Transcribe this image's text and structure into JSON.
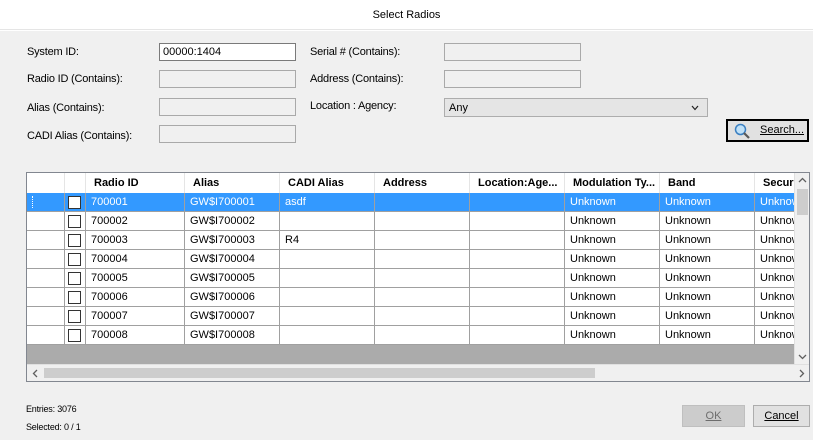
{
  "window": {
    "title": "Select Radios"
  },
  "filters": {
    "system_id": {
      "label": "System ID:",
      "value": "00000:1404"
    },
    "radio_id": {
      "label": "Radio ID (Contains):",
      "value": ""
    },
    "alias": {
      "label": "Alias (Contains):",
      "value": ""
    },
    "cadi_alias": {
      "label": "CADI Alias (Contains):",
      "value": ""
    },
    "serial": {
      "label": "Serial # (Contains):",
      "value": ""
    },
    "address": {
      "label": "Address (Contains):",
      "value": ""
    },
    "location_agency": {
      "label": "Location : Agency:",
      "value": "Any"
    }
  },
  "buttons": {
    "search": "Search...",
    "ok": "OK",
    "cancel": "Cancel"
  },
  "grid": {
    "columns": [
      "Radio ID",
      "Alias",
      "CADI Alias",
      "Address",
      "Location:Age...",
      "Modulation Ty...",
      "Band",
      "Securi"
    ],
    "rows": [
      {
        "radio_id": "700001",
        "alias": "GW$I700001",
        "cadi_alias": "asdf",
        "address": "",
        "location": "",
        "modulation": "Unknown",
        "band": "Unknown",
        "security": "Unknow",
        "selected": true
      },
      {
        "radio_id": "700002",
        "alias": "GW$I700002",
        "cadi_alias": "",
        "address": "",
        "location": "",
        "modulation": "Unknown",
        "band": "Unknown",
        "security": "Unknow",
        "selected": false
      },
      {
        "radio_id": "700003",
        "alias": "GW$I700003",
        "cadi_alias": "R4",
        "address": "",
        "location": "",
        "modulation": "Unknown",
        "band": "Unknown",
        "security": "Unknow",
        "selected": false
      },
      {
        "radio_id": "700004",
        "alias": "GW$I700004",
        "cadi_alias": "",
        "address": "",
        "location": "",
        "modulation": "Unknown",
        "band": "Unknown",
        "security": "Unknow",
        "selected": false
      },
      {
        "radio_id": "700005",
        "alias": "GW$I700005",
        "cadi_alias": "",
        "address": "",
        "location": "",
        "modulation": "Unknown",
        "band": "Unknown",
        "security": "Unknow",
        "selected": false
      },
      {
        "radio_id": "700006",
        "alias": "GW$I700006",
        "cadi_alias": "",
        "address": "",
        "location": "",
        "modulation": "Unknown",
        "band": "Unknown",
        "security": "Unknow",
        "selected": false
      },
      {
        "radio_id": "700007",
        "alias": "GW$I700007",
        "cadi_alias": "",
        "address": "",
        "location": "",
        "modulation": "Unknown",
        "band": "Unknown",
        "security": "Unknow",
        "selected": false
      },
      {
        "radio_id": "700008",
        "alias": "GW$I700008",
        "cadi_alias": "",
        "address": "",
        "location": "",
        "modulation": "Unknown",
        "band": "Unknown",
        "security": "Unknow",
        "selected": false
      }
    ]
  },
  "status": {
    "entries": "Entries: 3076",
    "selected": "Selected: 0 / 1"
  },
  "colors": {
    "selection": "#3399ff",
    "background": "#f0f0f0",
    "grid_empty": "#ababab"
  },
  "icons": {
    "search": "magnifier-icon"
  }
}
